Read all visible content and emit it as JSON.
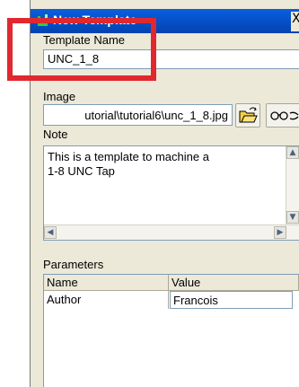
{
  "window": {
    "title": "New Template",
    "close_glyph": "X"
  },
  "form": {
    "template_name_label": "Template Name",
    "template_name_value": "UNC_1_8",
    "image_label": "Image",
    "image_path": "utorial\\tutorial6\\unc_1_8.jpg",
    "note_label": "Note",
    "note_text": "This is a template to machine a\n1-8 UNC Tap",
    "parameters_label": "Parameters"
  },
  "parameters": {
    "columns": [
      "Name",
      "Value"
    ],
    "rows": [
      {
        "name": "Author",
        "value": "Francois"
      }
    ]
  },
  "icons": {
    "title": "template-icon",
    "browse": "open-folder-icon",
    "view": "glasses-icon",
    "close": "close-icon"
  },
  "colors": {
    "titlebar": "#0a5fde",
    "highlight": "#e0282e",
    "dialog_bg": "#ece9d8"
  }
}
